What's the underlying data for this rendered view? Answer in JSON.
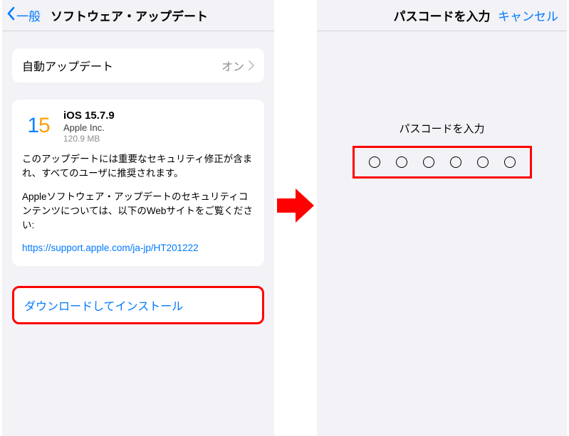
{
  "left": {
    "nav": {
      "back_label": "一般",
      "title": "ソフトウェア・アップデート"
    },
    "auto": {
      "label": "自動アップデート",
      "value": "オン"
    },
    "update": {
      "os_title": "iOS 15.7.9",
      "vendor": "Apple Inc.",
      "size": "120.9 MB",
      "desc1": "このアップデートには重要なセキュリティ修正が含まれ、すべてのユーザに推奨されます。",
      "desc2": "Appleソフトウェア・アップデートのセキュリティコンテンツについては、以下のWebサイトをご覧ください:",
      "link": "https://support.apple.com/ja-jp/HT201222"
    },
    "download_label": "ダウンロードしてインストール"
  },
  "right": {
    "nav": {
      "title": "パスコードを入力",
      "cancel": "キャンセル"
    },
    "passcode_label": "パスコードを入力"
  }
}
